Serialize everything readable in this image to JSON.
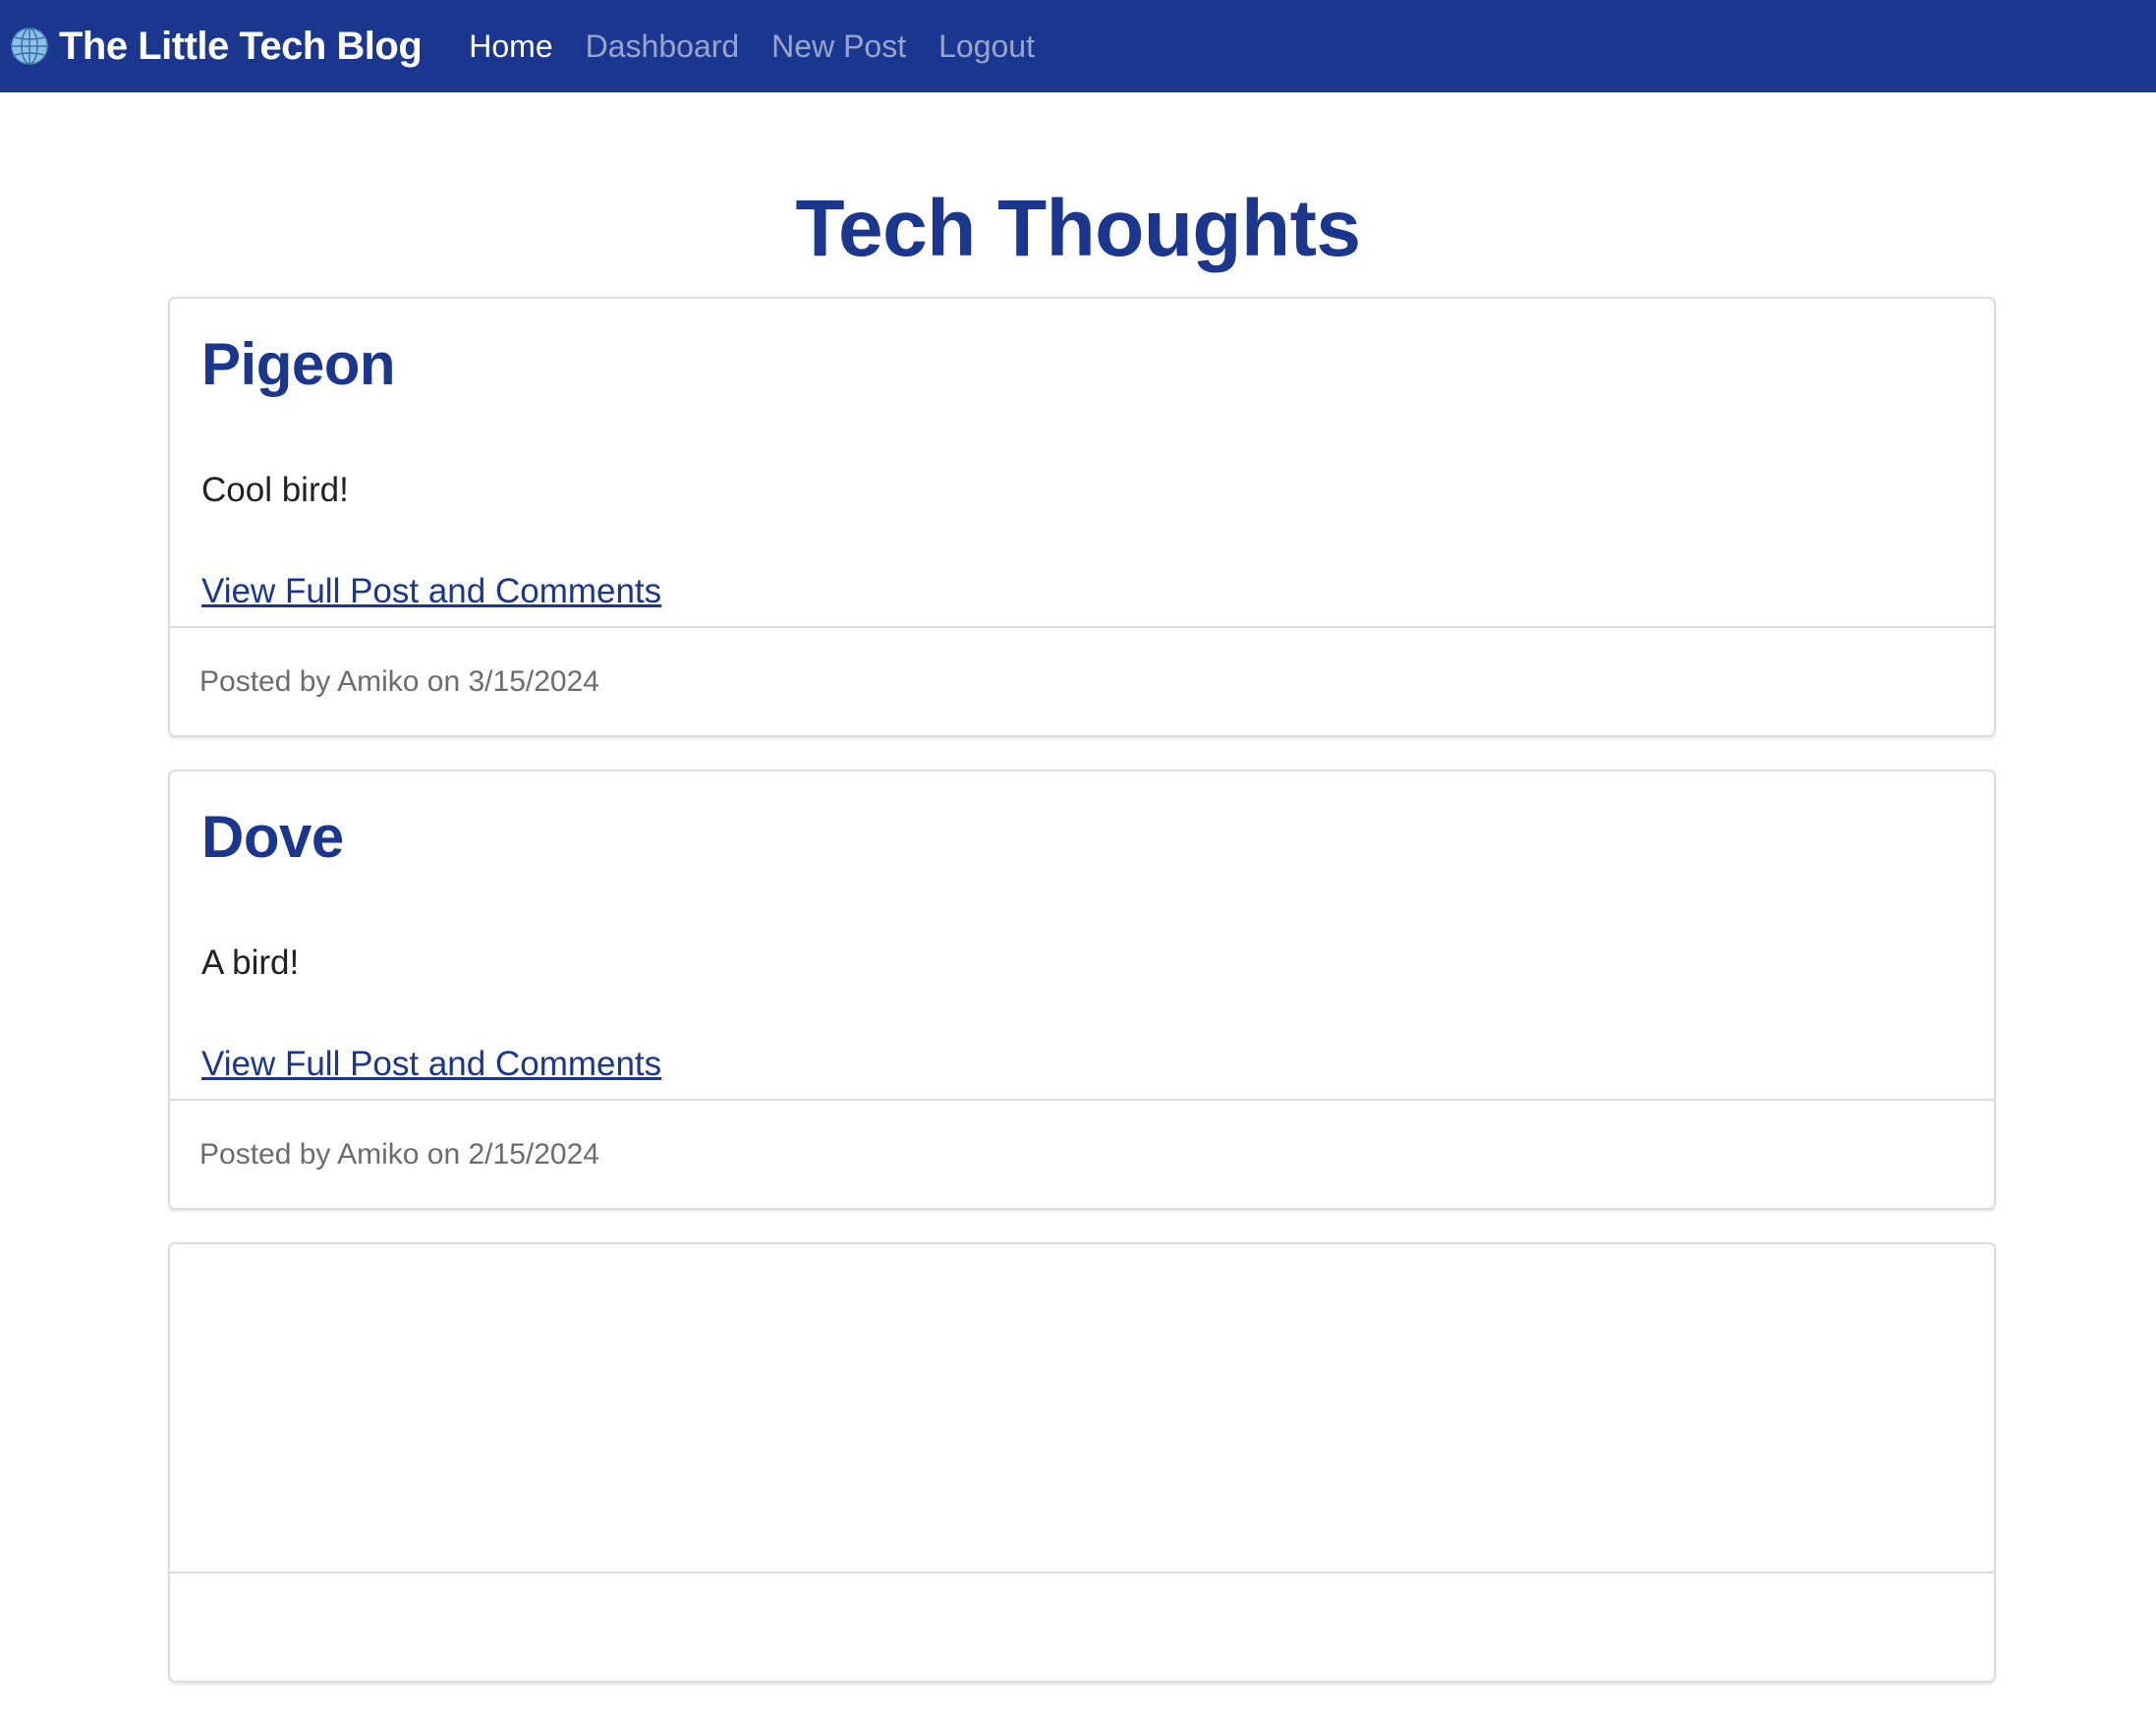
{
  "navbar": {
    "brand_icon": "globe-icon",
    "brand": "The Little Tech Blog",
    "links": [
      {
        "label": "Home",
        "active": true
      },
      {
        "label": "Dashboard",
        "active": false
      },
      {
        "label": "New Post",
        "active": false
      },
      {
        "label": "Logout",
        "active": false
      }
    ],
    "background_color": "#1a368f"
  },
  "main": {
    "title": "Tech Thoughts",
    "title_color": "#1a368f",
    "posts": [
      {
        "title": "Pigeon",
        "content": "Cool bird!",
        "link_label": "View Full Post and Comments",
        "footer": "Posted by Amiko on 3/15/2024"
      },
      {
        "title": "Dove",
        "content": "A bird!",
        "link_label": "View Full Post and Comments",
        "footer": "Posted by Amiko on 2/15/2024"
      },
      {
        "title": "",
        "content": "",
        "link_label": "",
        "footer": ""
      }
    ]
  }
}
